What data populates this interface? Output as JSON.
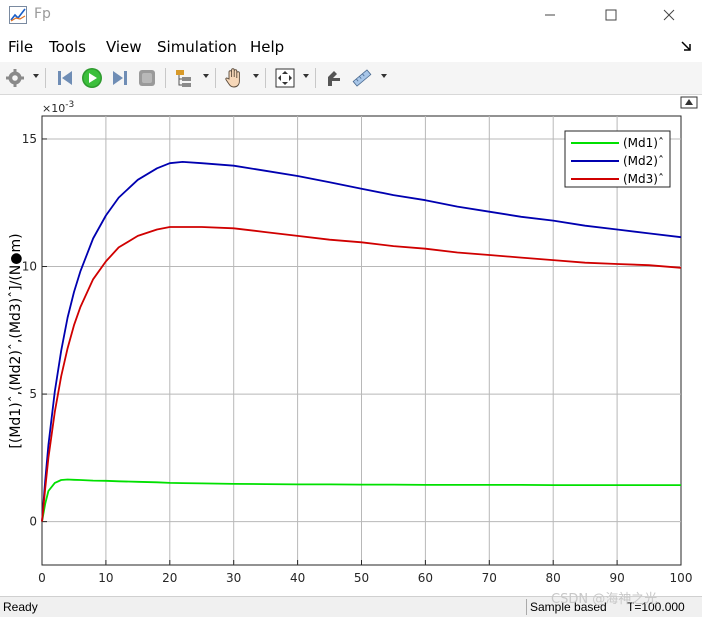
{
  "window": {
    "title": "Fp",
    "minimize": "—",
    "maximize": "☐",
    "close": "✕"
  },
  "menu": [
    {
      "key": "file",
      "label": "File"
    },
    {
      "key": "tools",
      "label": "Tools"
    },
    {
      "key": "view",
      "label": "View"
    },
    {
      "key": "simulation",
      "label": "Simulation"
    },
    {
      "key": "help",
      "label": "Help"
    }
  ],
  "toolbar_icons": [
    "settings-icon",
    "step-back-icon",
    "run-icon",
    "step-forward-icon",
    "stop-icon",
    "signal-hierarchy-icon",
    "pan-icon",
    "zoom-fit-icon",
    "highlight-icon",
    "measure-icon"
  ],
  "status": {
    "ready": "Ready",
    "sample": "Sample based",
    "time": "T=100.000"
  },
  "watermark": "CSDN @海神之光",
  "colors": {
    "md1": "#00e000",
    "md2": "#0000b0",
    "md3": "#d00000",
    "grid": "#b8b8b8"
  },
  "chart_data": {
    "type": "line",
    "xlabel": "",
    "ylabel": "[(Md1)ˆ,(Md2)ˆ,(Md3)ˆ]/(N●m)",
    "exponent_label": "×10",
    "exponent_power": "-3",
    "xlim": [
      0,
      100
    ],
    "ylim": [
      -1.7,
      15.9
    ],
    "xticks": [
      0,
      10,
      20,
      30,
      40,
      50,
      60,
      70,
      80,
      90,
      100
    ],
    "yticks": [
      0,
      5,
      10,
      15
    ],
    "grid": true,
    "legend_position": "top-right",
    "x": [
      0,
      0.5,
      1,
      2,
      3,
      4,
      5,
      6,
      8,
      10,
      12,
      15,
      18,
      20,
      22,
      25,
      30,
      35,
      40,
      45,
      50,
      55,
      60,
      65,
      70,
      75,
      80,
      85,
      90,
      95,
      100
    ],
    "series": [
      {
        "name": "(Md1)ˆ",
        "color": "#00e000",
        "values": [
          0,
          0.7,
          1.2,
          1.52,
          1.63,
          1.65,
          1.64,
          1.63,
          1.61,
          1.6,
          1.58,
          1.56,
          1.54,
          1.52,
          1.51,
          1.5,
          1.48,
          1.47,
          1.46,
          1.46,
          1.45,
          1.45,
          1.44,
          1.44,
          1.44,
          1.44,
          1.43,
          1.43,
          1.43,
          1.43,
          1.43
        ]
      },
      {
        "name": "(Md2)ˆ",
        "color": "#0000b0",
        "values": [
          0,
          1.6,
          3.0,
          5.1,
          6.7,
          8.0,
          9.0,
          9.8,
          11.1,
          12.0,
          12.7,
          13.4,
          13.85,
          14.05,
          14.1,
          14.05,
          13.95,
          13.75,
          13.55,
          13.3,
          13.05,
          12.8,
          12.6,
          12.35,
          12.15,
          11.95,
          11.8,
          11.6,
          11.45,
          11.3,
          11.15
        ]
      },
      {
        "name": "(Md3)ˆ",
        "color": "#d00000",
        "values": [
          0,
          1.3,
          2.5,
          4.3,
          5.7,
          6.8,
          7.7,
          8.4,
          9.5,
          10.2,
          10.75,
          11.2,
          11.45,
          11.55,
          11.55,
          11.55,
          11.5,
          11.35,
          11.2,
          11.05,
          10.95,
          10.8,
          10.7,
          10.55,
          10.45,
          10.35,
          10.25,
          10.15,
          10.1,
          10.05,
          9.95
        ]
      }
    ]
  }
}
